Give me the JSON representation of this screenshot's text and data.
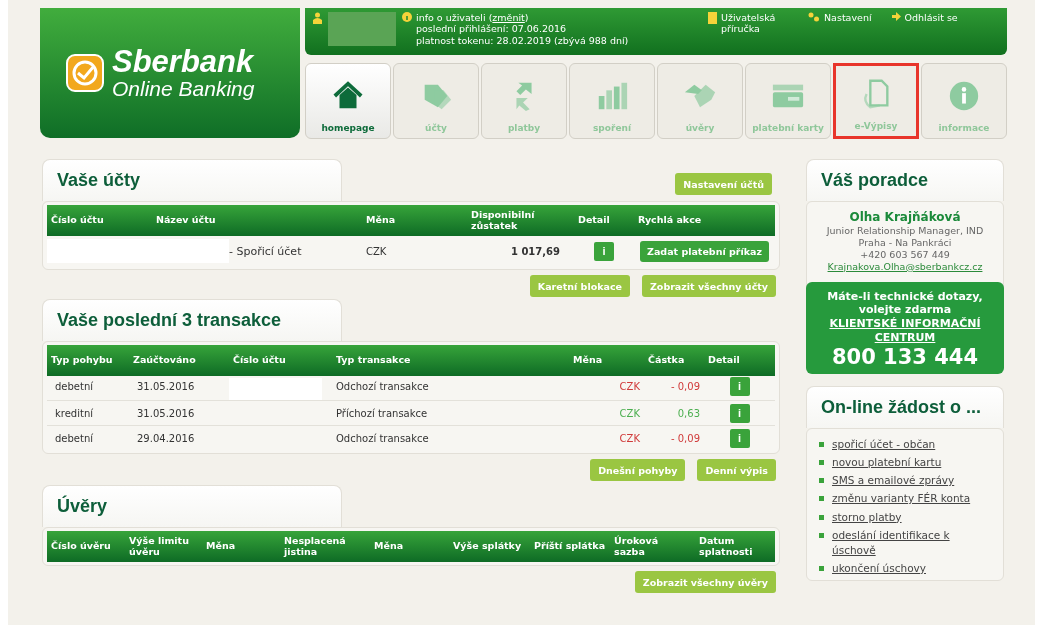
{
  "logo": {
    "name": "Sberbank",
    "subtitle": "Online Banking"
  },
  "top_bar": {
    "info_before": "info o uživateli (",
    "info_link": "změnit",
    "info_after": ")",
    "last_login": "poslední přihlášení: 07.06.2016",
    "token": "platnost tokenu: 28.02.2019 (zbývá 988 dní)",
    "manual": "Uživatelská příručka",
    "settings": "Nastavení",
    "logout": "Odhlásit se"
  },
  "tabs": [
    {
      "label": "homepage",
      "selected": true,
      "highlighted": false
    },
    {
      "label": "účty",
      "selected": false,
      "highlighted": false
    },
    {
      "label": "platby",
      "selected": false,
      "highlighted": false
    },
    {
      "label": "spoření",
      "selected": false,
      "highlighted": false
    },
    {
      "label": "úvěry",
      "selected": false,
      "highlighted": false
    },
    {
      "label": "platební karty",
      "selected": false,
      "highlighted": false
    },
    {
      "label": "e-Výpisy",
      "selected": false,
      "highlighted": true
    },
    {
      "label": "informace",
      "selected": false,
      "highlighted": false
    }
  ],
  "accounts": {
    "title": "Vaše účty",
    "top_button": "Nastavení účtů",
    "columns": [
      "Číslo účtu",
      "Název účtu",
      "Měna",
      "Disponibilní zůstatek",
      "Detail",
      "Rychlá akce"
    ],
    "rows": [
      {
        "name": "- Spořicí účet",
        "currency": "CZK",
        "balance": "1 017,69",
        "detail": "i",
        "action": "Zadat platební příkaz"
      }
    ],
    "buttons": [
      "Karetní blokace",
      "Zobrazit všechny účty"
    ]
  },
  "transactions": {
    "title": "Vaše poslední 3 transakce",
    "columns": [
      "Typ pohybu",
      "Zaúčtováno",
      "Číslo účtu",
      "Typ transakce",
      "Měna",
      "Částka",
      "Detail"
    ],
    "rows": [
      {
        "type": "debetní",
        "date": "31.05.2016",
        "description": "Odchozí transakce",
        "currency": "CZK",
        "amount": "- 0,09",
        "color": "#d03a3a",
        "detail": "i"
      },
      {
        "type": "kreditní",
        "date": "31.05.2016",
        "description": "Příchozí transakce",
        "currency": "CZK",
        "amount": "0,63",
        "color": "#4caf50",
        "detail": "i"
      },
      {
        "type": "debetní",
        "date": "29.04.2016",
        "description": "Odchozí transakce",
        "currency": "CZK",
        "amount": "- 0,09",
        "color": "#d03a3a",
        "detail": "i"
      }
    ],
    "buttons": [
      "Dnešní pohyby",
      "Denní výpis"
    ]
  },
  "loans": {
    "title": "Úvěry",
    "columns": [
      "Číslo úvěru",
      "Výše limitu úvěru",
      "Měna",
      "Nesplacená jistina",
      "Měna",
      "Výše splátky",
      "Příští splátka",
      "Úroková sazba",
      "Datum splatnosti"
    ],
    "buttons": [
      "Zobrazit všechny úvěry"
    ]
  },
  "advisor": {
    "title": "Váš poradce",
    "name": "Olha Krajňáková",
    "role": "Junior Relationship Manager, IND",
    "branch": "Praha - Na Pankráci",
    "phone": "+420 603 567 449",
    "email": "Krajnakova.Olha@sberbankcz.cz"
  },
  "helpline": {
    "text": "Máte-li technické dotazy, volejte zdarma",
    "link": "KLIENTSKÉ INFORMAČNÍ CENTRUM",
    "phone": "800 133 444"
  },
  "requests": {
    "title": "On-line žádost o ...",
    "items": [
      "spořicí účet - občan",
      "novou platební kartu",
      "SMS a emailové zprávy",
      "změnu varianty FÉR konta",
      "storno platby",
      "odeslání identifikace k úschově",
      "ukončení úschovy"
    ]
  }
}
